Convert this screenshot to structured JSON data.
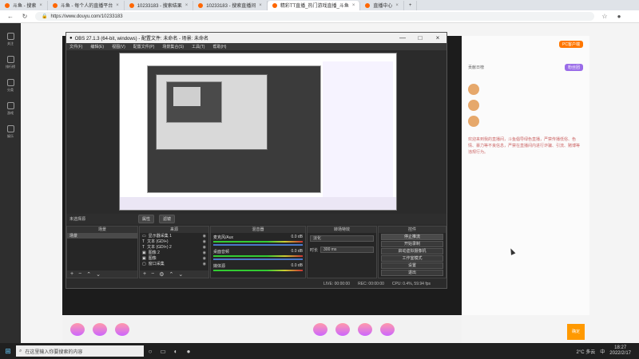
{
  "browser": {
    "tabs": [
      {
        "label": "斗鱼 - 搜索"
      },
      {
        "label": "斗鱼 - 每个人的直播平台"
      },
      {
        "label": "10233183 - 搜索结果"
      },
      {
        "label": "10233183 - 搜索直播间"
      },
      {
        "label": "精彩TT直播_热门游戏直播_斗鱼"
      },
      {
        "label": "直播中心"
      }
    ],
    "url": "https://www.douyu.com/10233183"
  },
  "leftnav": [
    {
      "label": "关注"
    },
    {
      "label": "排行榜"
    },
    {
      "label": "分类"
    },
    {
      "label": "游戏"
    },
    {
      "label": "娱乐"
    }
  ],
  "obs": {
    "title": "OBS 27.1.3 (64-bit, windows) - 配置文件: 未命名 - 场景: 未命名",
    "menu": [
      "文件(F)",
      "编辑(E)",
      "视图(V)",
      "配置文件(P)",
      "场景集合(S)",
      "工具(T)",
      "帮助(H)"
    ],
    "source_bar_label": "未选择源",
    "props_button": "属性",
    "filters_button": "滤镜",
    "docks": {
      "scenes": "场景",
      "sources": "来源",
      "mixer": "混音器",
      "transitions": "转场特效",
      "controls": "控件"
    },
    "scenes": [
      "场景"
    ],
    "sources": [
      "显示器采集 1",
      "文本 (GDI+)",
      "文本 (GDI+) 2",
      "图像 2",
      "图像",
      "窗口采集"
    ],
    "mixer": [
      {
        "name": "麦克风/Aux",
        "value": "0.0 dB"
      },
      {
        "name": "桌面音频",
        "value": "0.0 dB"
      },
      {
        "name": "媒体源",
        "value": "0.0 dB"
      }
    ],
    "transition": {
      "type": "淡化",
      "duration_label": "时长",
      "duration": "300 ms"
    },
    "controls": [
      "停止推流",
      "开始录制",
      "启动虚拟摄像机",
      "工作室模式",
      "设置",
      "退出"
    ],
    "status": {
      "live": "LIVE: 00:00:00",
      "rec": "REC: 00:00:00",
      "cpu": "CPU: 0.4%, 59.94 fps"
    }
  },
  "douyu": {
    "follow_btn": "PC客户端",
    "right_title": "贡献日榜",
    "sub_count": "粉丝团",
    "notice": "欢迎来到我的直播间，斗鱼倡导绿色直播，严禁传播低俗、色情、暴力等不良信息，严禁在直播间内进行诈骗、引流、赌博等违规行为。",
    "cancel_btn": "确定"
  },
  "taskbar": {
    "search_placeholder": "在这里输入你要搜索的内容",
    "weather": "2°C 多云",
    "time": "18:27",
    "date": "2022/2/17",
    "ime": "中"
  }
}
